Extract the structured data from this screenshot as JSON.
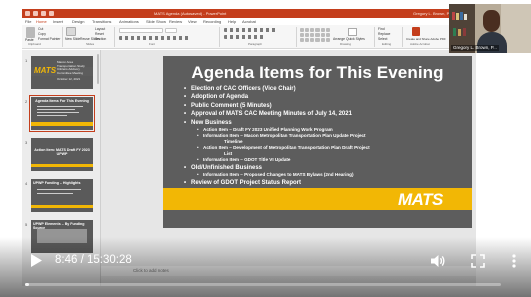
{
  "app": {
    "window_title": "MATS Agenda (Autosaved) - PowerPoint",
    "user": "Gregory L. Brown, P...",
    "tabs": [
      "File",
      "Home",
      "Insert",
      "Design",
      "Transitions",
      "Animations",
      "Slide Show",
      "Review",
      "View",
      "Recording",
      "Help",
      "Acrobat"
    ],
    "active_tab": "Home",
    "ribbon_groups": [
      "Clipboard",
      "Slides",
      "Font",
      "Paragraph",
      "Drawing",
      "Editing",
      "Adobe Acrobat"
    ],
    "ribbon_buttons": {
      "paste": "Paste",
      "cut": "Cut",
      "copy": "Copy",
      "format_painter": "Format Painter",
      "new_slide": "New Slide",
      "reuse_slides": "Reuse Slides",
      "layout": "Layout",
      "reset": "Reset",
      "section": "Section",
      "arrange": "Arrange",
      "quick_styles": "Quick Styles",
      "find": "Find",
      "replace": "Replace",
      "select": "Select",
      "create_share": "Create and Share Adobe PDF"
    },
    "notes_placeholder": "Click to add notes"
  },
  "thumbnails": [
    {
      "num": "1",
      "title": "Macon Area Transportation Study Citizens Advisory Committee Meeting",
      "date": "October 12, 2021",
      "logo": "MATS"
    },
    {
      "num": "2",
      "title": "Agenda Items For This Evening"
    },
    {
      "num": "3",
      "title": "Action Item: MATS Draft FY 2023 UPWP"
    },
    {
      "num": "4",
      "title": "UPWP Funding – Highlights"
    },
    {
      "num": "5",
      "title": "UPWP Elements – By Funding Source"
    }
  ],
  "slide": {
    "title": "Agenda Items for This Evening",
    "logo": "MATS",
    "items": [
      {
        "level": 1,
        "text": "Election of CAC Officers (Vice Chair)"
      },
      {
        "level": 1,
        "text": "Adoption of Agenda"
      },
      {
        "level": 1,
        "text": "Public Comment (5 Minutes)"
      },
      {
        "level": 1,
        "text": "Approval of MATS CAC Meeting Minutes of July 14, 2021"
      },
      {
        "level": 1,
        "text": "New Business"
      },
      {
        "level": 2,
        "text": "Action Item – Draft FY 2023 Unified Planning Work Program"
      },
      {
        "level": 2,
        "text": "Information Item – Macon Metropolitan Transportation Plan Update Project"
      },
      {
        "level": 3,
        "text": "Timeline"
      },
      {
        "level": 2,
        "text": "Action Item – Development of Metropolitan Transportation Plan Draft Project"
      },
      {
        "level": 3,
        "text": "List"
      },
      {
        "level": 2,
        "text": "Information Item – GDOT Title VI Update"
      },
      {
        "level": 1,
        "text": "Old/Unfinished Business"
      },
      {
        "level": 2,
        "text": "Information Item – Proposed Changes to MATS Bylaws (2nd Hearing)"
      },
      {
        "level": 1,
        "text": "Review of GDOT Project Status Report"
      }
    ]
  },
  "webcam": {
    "name_label": "Gregory L. Brown, P..."
  },
  "player": {
    "current_time": "8:46",
    "separator": " / ",
    "duration": "15:30:28",
    "progress_fraction": 0.0094,
    "icons": [
      "play-icon",
      "volume-icon",
      "fullscreen-icon",
      "more-options-icon"
    ]
  },
  "colors": {
    "accent": "#c43e1c",
    "slide_background": "#5d5d5d",
    "brand_band": "#f2b705"
  }
}
